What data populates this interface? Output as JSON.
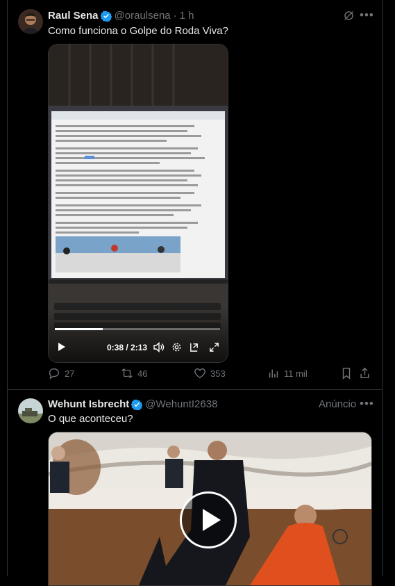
{
  "post1": {
    "name": "Raul Sena",
    "handle": "@oraulsena",
    "separator": "·",
    "time": "1 h",
    "text": "Como funciona o Golpe do Roda Viva?",
    "video": {
      "elapsed": "0:38",
      "duration": "2:13",
      "time_display": "0:38 / 2:13",
      "progress": 0.29
    },
    "actions": {
      "replies": "27",
      "reposts": "46",
      "likes": "353",
      "views": "11 mil"
    }
  },
  "post2": {
    "name": "Wehunt Isbrecht",
    "handle": "@WehuntI2638",
    "ad_label": "Anúncio",
    "text": "O que aconteceu?"
  },
  "colors": {
    "background": "#000000",
    "text": "#e7e9ea",
    "muted": "#71767b",
    "verified": "#1d9bf0",
    "border": "#2f3336"
  }
}
